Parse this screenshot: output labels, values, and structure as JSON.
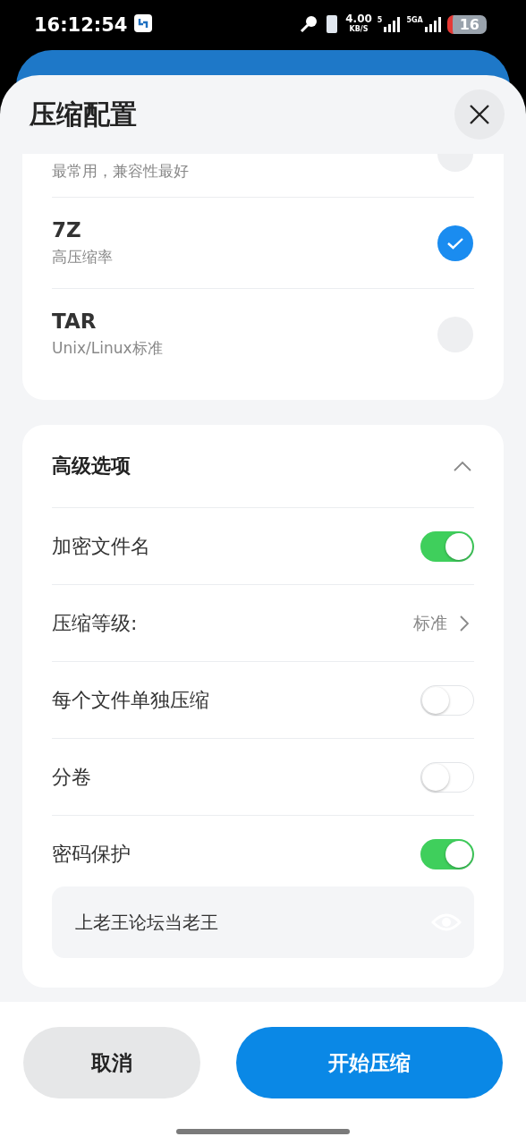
{
  "status_bar": {
    "time": "16:12:54",
    "speed": "4.00",
    "speed_unit": "KB/S",
    "sim1_label": "5",
    "sim2_label": "5GA",
    "battery": "16"
  },
  "sheet": {
    "title": "压缩配置"
  },
  "formats": [
    {
      "subtitle": "最常用，兼容性最好",
      "selected": false
    },
    {
      "title": "7Z",
      "subtitle": "高压缩率",
      "selected": true
    },
    {
      "title": "TAR",
      "subtitle": "Unix/Linux标准",
      "selected": false
    }
  ],
  "advanced": {
    "title": "高级选项",
    "expanded": true,
    "options": [
      {
        "kind": "toggle",
        "label": "加密文件名",
        "on": true
      },
      {
        "kind": "select",
        "label": "压缩等级:",
        "value": "标准"
      },
      {
        "kind": "toggle",
        "label": "每个文件单独压缩",
        "on": false
      },
      {
        "kind": "toggle",
        "label": "分卷",
        "on": false
      },
      {
        "kind": "toggle",
        "label": "密码保护",
        "on": true
      }
    ],
    "password": {
      "value": "上老王论坛当老王"
    }
  },
  "buttons": [
    {
      "kind": "secondary",
      "label": "取消"
    },
    {
      "kind": "primary",
      "label": "开始压缩"
    }
  ]
}
